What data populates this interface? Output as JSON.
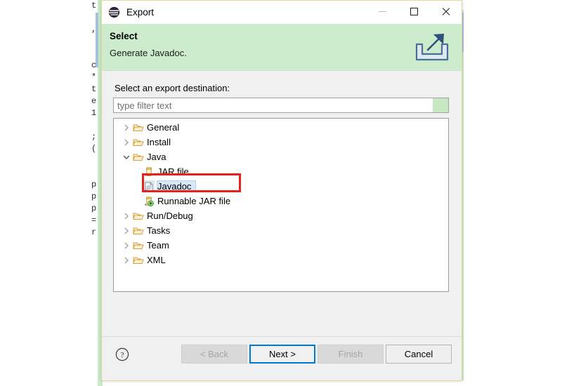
{
  "background": {
    "code_column": "t\n\n,\n\n\nc\n*\nt\ne\n1\n\n;\n(\n\n\np\np\np\n=\nr\n"
  },
  "dialog": {
    "titlebar": {
      "logo_icon": "eclipse-logo-icon",
      "title": "Export",
      "minimize_label": "Minimize",
      "maximize_label": "Maximize",
      "close_label": "Close"
    },
    "header": {
      "title": "Select",
      "subtitle": "Generate Javadoc.",
      "icon": "export-banner-icon"
    },
    "body": {
      "destination_label": "Select an export destination:",
      "filter": {
        "placeholder": "type filter text",
        "value": "",
        "badge_color": "#c8e8c4"
      },
      "tree": [
        {
          "label": "General",
          "level": 0,
          "expanded": false,
          "icon": "folder-icon",
          "selected": false
        },
        {
          "label": "Install",
          "level": 0,
          "expanded": false,
          "icon": "folder-icon",
          "selected": false
        },
        {
          "label": "Java",
          "level": 0,
          "expanded": true,
          "icon": "folder-icon",
          "selected": false
        },
        {
          "label": "JAR file",
          "level": 1,
          "expanded": null,
          "icon": "jar-file-icon",
          "selected": false
        },
        {
          "label": "Javadoc",
          "level": 1,
          "expanded": null,
          "icon": "javadoc-icon",
          "selected": true
        },
        {
          "label": "Runnable JAR file",
          "level": 1,
          "expanded": null,
          "icon": "runnable-jar-icon",
          "selected": false
        },
        {
          "label": "Run/Debug",
          "level": 0,
          "expanded": false,
          "icon": "folder-icon",
          "selected": false
        },
        {
          "label": "Tasks",
          "level": 0,
          "expanded": false,
          "icon": "folder-icon",
          "selected": false
        },
        {
          "label": "Team",
          "level": 0,
          "expanded": false,
          "icon": "folder-icon",
          "selected": false
        },
        {
          "label": "XML",
          "level": 0,
          "expanded": false,
          "icon": "folder-icon",
          "selected": false
        }
      ],
      "highlight": {
        "target": "Javadoc",
        "color": "#e8221b"
      }
    },
    "footer": {
      "help_label": "?",
      "back_label": "< Back",
      "next_label": "Next >",
      "finish_label": "Finish",
      "cancel_label": "Cancel",
      "back_enabled": false,
      "next_enabled": true,
      "finish_enabled": false,
      "cancel_enabled": true,
      "focus_button": "Next >"
    }
  },
  "colors": {
    "header_green": "#cdeccd",
    "dialog_border": "#e3d9a0",
    "focus_blue": "#0078d7",
    "selection_blue": "#d6e7f7",
    "highlight_red": "#e8221b"
  }
}
